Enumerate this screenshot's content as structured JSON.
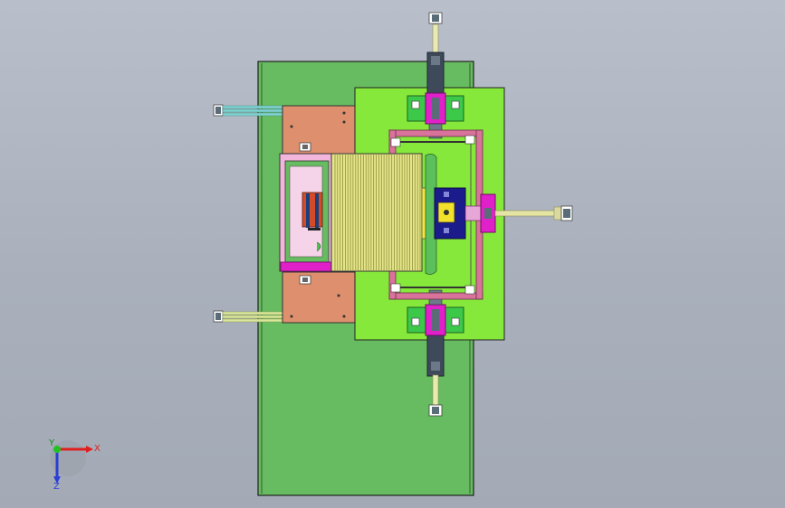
{
  "viewport": {
    "background": "#aeb4c0"
  },
  "colors": {
    "base_plate": "#67bb60",
    "top_plate": "#86e83a",
    "copper_block": "#dd8f6e",
    "slot_stack": "#e5e58a",
    "magenta": "#e020c8",
    "pink": "#f2b6dc",
    "rail": "#7fd3cf",
    "navy": "#1b1b8c",
    "yellow": "#f2e12a",
    "dark_bar": "#3e4a5a",
    "olive_rod": "#e4e4a4"
  },
  "triad": {
    "x_label": "X",
    "y_label": "Y",
    "z_label": "Z"
  }
}
